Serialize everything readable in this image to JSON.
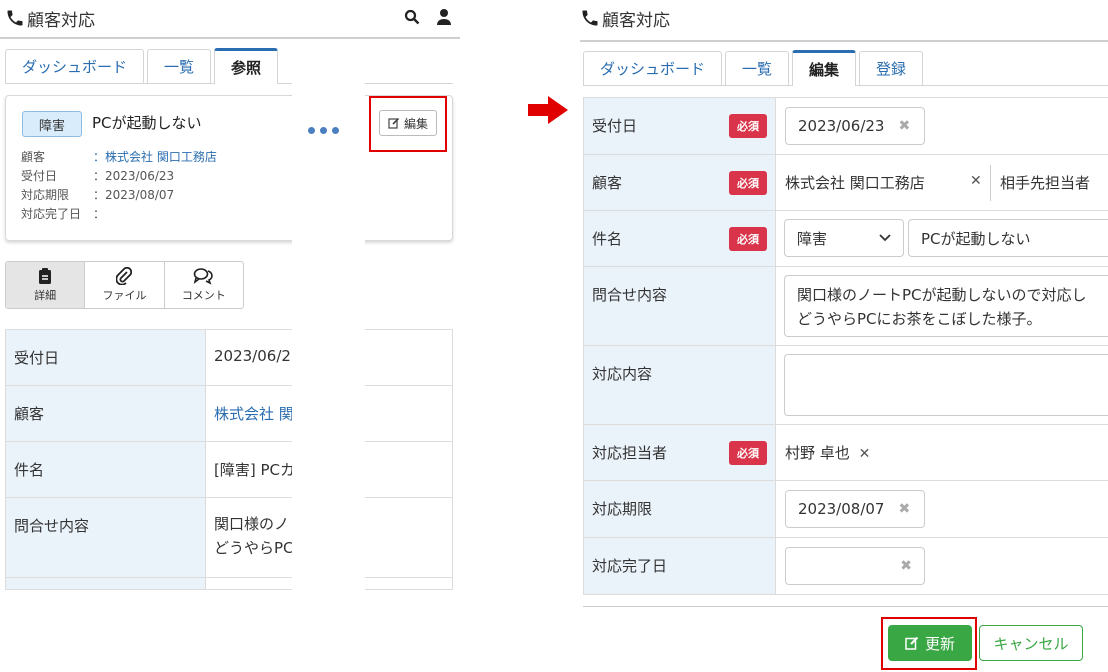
{
  "left": {
    "app_title": "顧客対応",
    "tabs": [
      "ダッシュボード",
      "一覧",
      "参照"
    ],
    "card": {
      "badge": "障害",
      "title": "PCが起動しない",
      "rows": [
        {
          "label": "顧客",
          "value": "：株式会社 関口工務店"
        },
        {
          "label": "受付日",
          "value": "：2023/06/23"
        },
        {
          "label": "対応期限",
          "value": "：2023/08/07"
        },
        {
          "label": "対応完了日",
          "value": "："
        }
      ],
      "edit_label": "編集"
    },
    "views": [
      "詳細",
      "ファイル",
      "コメント"
    ],
    "table": [
      {
        "label": "受付日",
        "value": "2023/06/2"
      },
      {
        "label": "顧客",
        "value": "株式会社 関"
      },
      {
        "label": "件名",
        "value": "[障害] PCカ"
      },
      {
        "label": "問合せ内容",
        "value": "関口様のノ",
        "value2": "どうやらPC"
      }
    ]
  },
  "right": {
    "app_title": "顧客対応",
    "tabs": [
      "ダッシュボード",
      "一覧",
      "編集",
      "登録"
    ],
    "required_label": "必須",
    "fields": {
      "received_label": "受付日",
      "received_value": "2023/06/23",
      "customer_label": "顧客",
      "customer_value": "株式会社 関口工務店",
      "customer_contact": "相手先担当者",
      "subject_label": "件名",
      "subject_category": "障害",
      "subject_value": "PCが起動しない",
      "inquiry_label": "問合せ内容",
      "inquiry_line1": "関口様のノートPCが起動しないので対応し",
      "inquiry_line2": "どうやらPCにお茶をこぼした様子。",
      "response_label": "対応内容",
      "assignee_label": "対応担当者",
      "assignee_value": "村野 卓也",
      "deadline_label": "対応期限",
      "deadline_value": "2023/08/07",
      "completed_label": "対応完了日"
    },
    "update_label": "更新",
    "cancel_label": "キャンセル"
  },
  "colors": {
    "accent": "#2a6db0",
    "required": "#d9344a",
    "update": "#3aa745",
    "highlight": "#e00000",
    "label_bg": "#eaf2fa"
  }
}
